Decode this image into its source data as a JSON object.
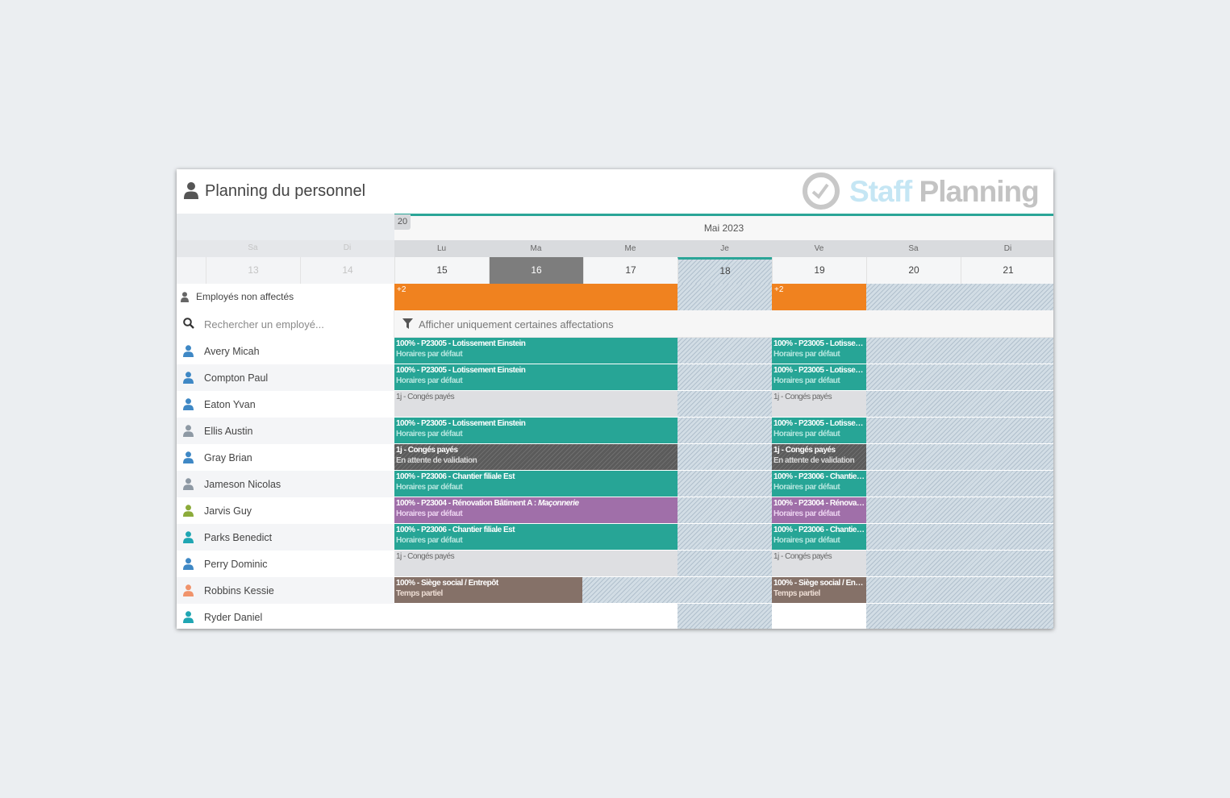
{
  "header": {
    "title": "Planning du personnel",
    "logo_part1": "Staff",
    "logo_part2": "Planning"
  },
  "calendar": {
    "week_number": "20",
    "month": "Mai  2023",
    "prev_days": [
      {
        "abbr": "Sa",
        "num": "13"
      },
      {
        "abbr": "Di",
        "num": "14"
      }
    ],
    "days": [
      {
        "abbr": "Lu",
        "num": "15"
      },
      {
        "abbr": "Ma",
        "num": "16"
      },
      {
        "abbr": "Me",
        "num": "17"
      },
      {
        "abbr": "Je",
        "num": "18"
      },
      {
        "abbr": "Ve",
        "num": "19"
      },
      {
        "abbr": "Sa",
        "num": "20"
      },
      {
        "abbr": "Di",
        "num": "21"
      }
    ]
  },
  "unassigned": {
    "label": "Employés non affectés",
    "count_a": "+2",
    "count_b": "+2"
  },
  "search": {
    "placeholder": "Rechercher un employé...",
    "filter_label": "Afficher uniquement certaines affectations"
  },
  "colors": {
    "accent": "#2ba597",
    "orange": "#f0821f",
    "teal": "#27a596",
    "purple": "#a06fa9",
    "brown": "#857168"
  },
  "employees": [
    {
      "name": "Avery Micah",
      "icon_color": "#3f88c5",
      "mon_l1": "100% - P23005 - Lotissement Einstein",
      "mon_l2": "Horaires par défaut",
      "fri_l1": "100% - P23005 - Lotisseme...",
      "fri_l2": "Horaires par défaut"
    },
    {
      "name": "Compton Paul",
      "icon_color": "#3f88c5",
      "mon_l1": "100% - P23005 - Lotissement Einstein",
      "mon_l2": "Horaires par défaut",
      "fri_l1": "100% - P23005 - Lotisseme...",
      "fri_l2": "Horaires par défaut"
    },
    {
      "name": "Eaton Yvan",
      "icon_color": "#3f88c5",
      "mon_l1": "1j - Congés payés",
      "fri_l1": "1j - Congés payés"
    },
    {
      "name": "Ellis Austin",
      "icon_color": "#8e99a4",
      "mon_l1": "100% - P23005 - Lotissement Einstein",
      "mon_l2": "Horaires par défaut",
      "fri_l1": "100% - P23005 - Lotisseme...",
      "fri_l2": "Horaires par défaut"
    },
    {
      "name": "Gray Brian",
      "icon_color": "#3f88c5",
      "mon_l1": "1j - Congés payés",
      "mon_l2": "En attente de validation",
      "fri_l1": "1j - Congés payés",
      "fri_l2": "En attente de validation"
    },
    {
      "name": "Jameson Nicolas",
      "icon_color": "#8e99a4",
      "mon_l1": "100% - P23006 - Chantier filiale Est",
      "mon_l2": "Horaires par défaut",
      "fri_l1": "100% - P23006 - Chantier fil...",
      "fri_l2": "Horaires par défaut"
    },
    {
      "name": "Jarvis Guy",
      "icon_color": "#8cab3a",
      "mon_l1": "100% - P23004 - Rénovation Bâtiment A : ",
      "mon_l1b": "Maçonnerie",
      "mon_l2": "Horaires par défaut",
      "fri_l1": "100% - P23004 - Rénovatio...",
      "fri_l2": "Horaires par défaut"
    },
    {
      "name": "Parks Benedict",
      "icon_color": "#20a6b3",
      "mon_l1": "100% - P23006 - Chantier filiale Est",
      "mon_l2": "Horaires par défaut",
      "fri_l1": "100% - P23006 - Chantier fil...",
      "fri_l2": "Horaires par défaut"
    },
    {
      "name": "Perry Dominic",
      "icon_color": "#3f88c5",
      "mon_l1": "1j - Congés payés",
      "fri_l1": "1j - Congés payés"
    },
    {
      "name": "Robbins Kessie",
      "icon_color": "#f0936b",
      "mon_l1": "100% - Siège social / Entrepôt",
      "mon_l2": "Temps partiel",
      "fri_l1": "100% - Siège social / Entrep...",
      "fri_l2": "Temps partiel"
    },
    {
      "name": "Ryder Daniel",
      "icon_color": "#20a6b3"
    }
  ]
}
